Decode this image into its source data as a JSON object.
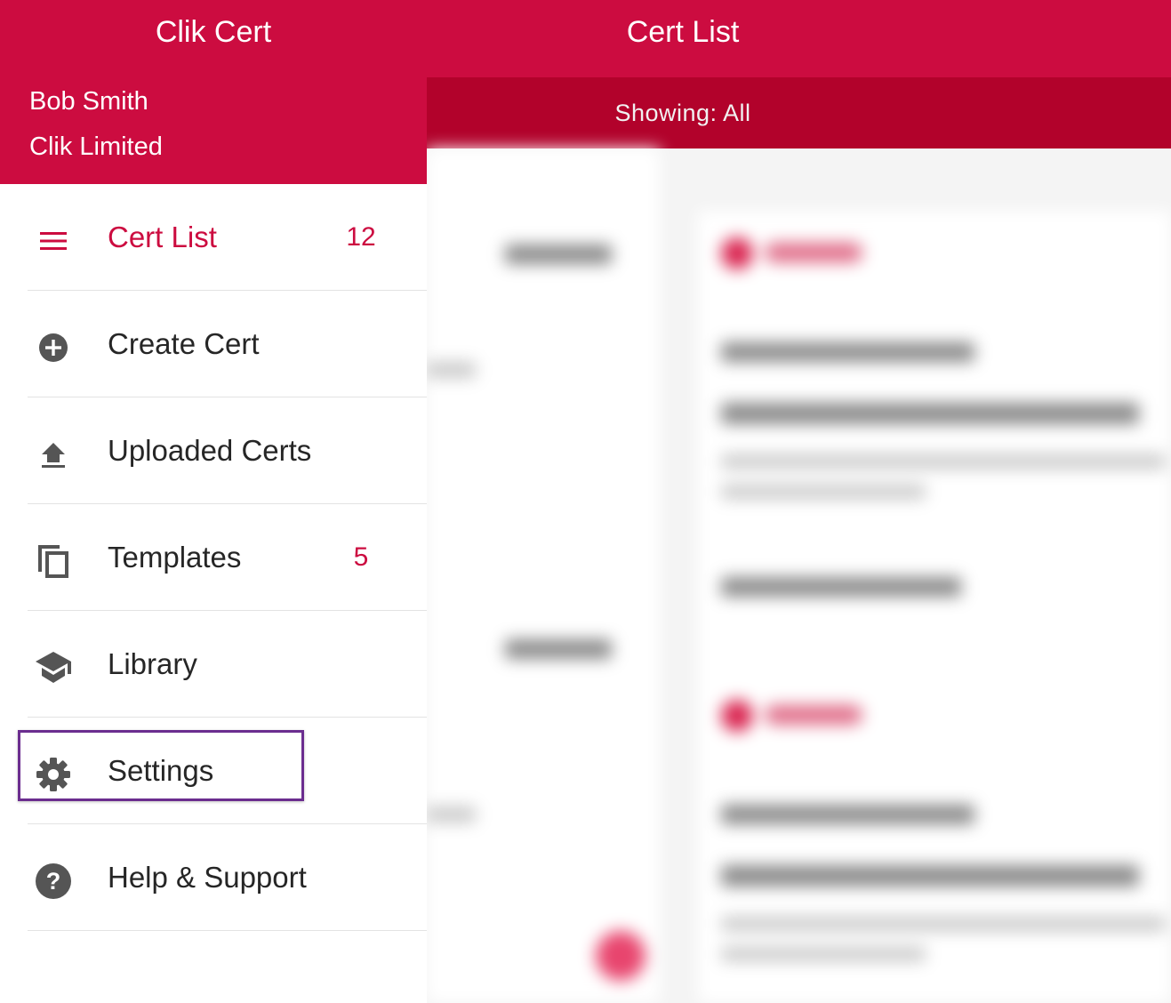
{
  "sidebar": {
    "app_title": "Clik Cert",
    "user_name": "Bob Smith",
    "company": "Clik Limited",
    "items": [
      {
        "label": "Cert List",
        "count": "12",
        "icon": "menu-icon",
        "active": true
      },
      {
        "label": "Create Cert",
        "count": "",
        "icon": "add-circle-icon",
        "active": false
      },
      {
        "label": "Uploaded Certs",
        "count": "",
        "icon": "upload-icon",
        "active": false
      },
      {
        "label": "Templates",
        "count": "5",
        "icon": "copy-icon",
        "active": false
      },
      {
        "label": "Library",
        "count": "",
        "icon": "school-icon",
        "active": false
      },
      {
        "label": "Settings",
        "count": "",
        "icon": "gear-icon",
        "active": false
      },
      {
        "label": "Help & Support",
        "count": "",
        "icon": "help-icon",
        "active": false
      }
    ]
  },
  "main": {
    "title": "Cert List",
    "filter_label": "Showing: All"
  },
  "colors": {
    "brand": "#cc0c40",
    "brand_dark": "#b2022b",
    "highlight": "#6b2d8f",
    "text": "#262626",
    "icon": "#555555"
  }
}
